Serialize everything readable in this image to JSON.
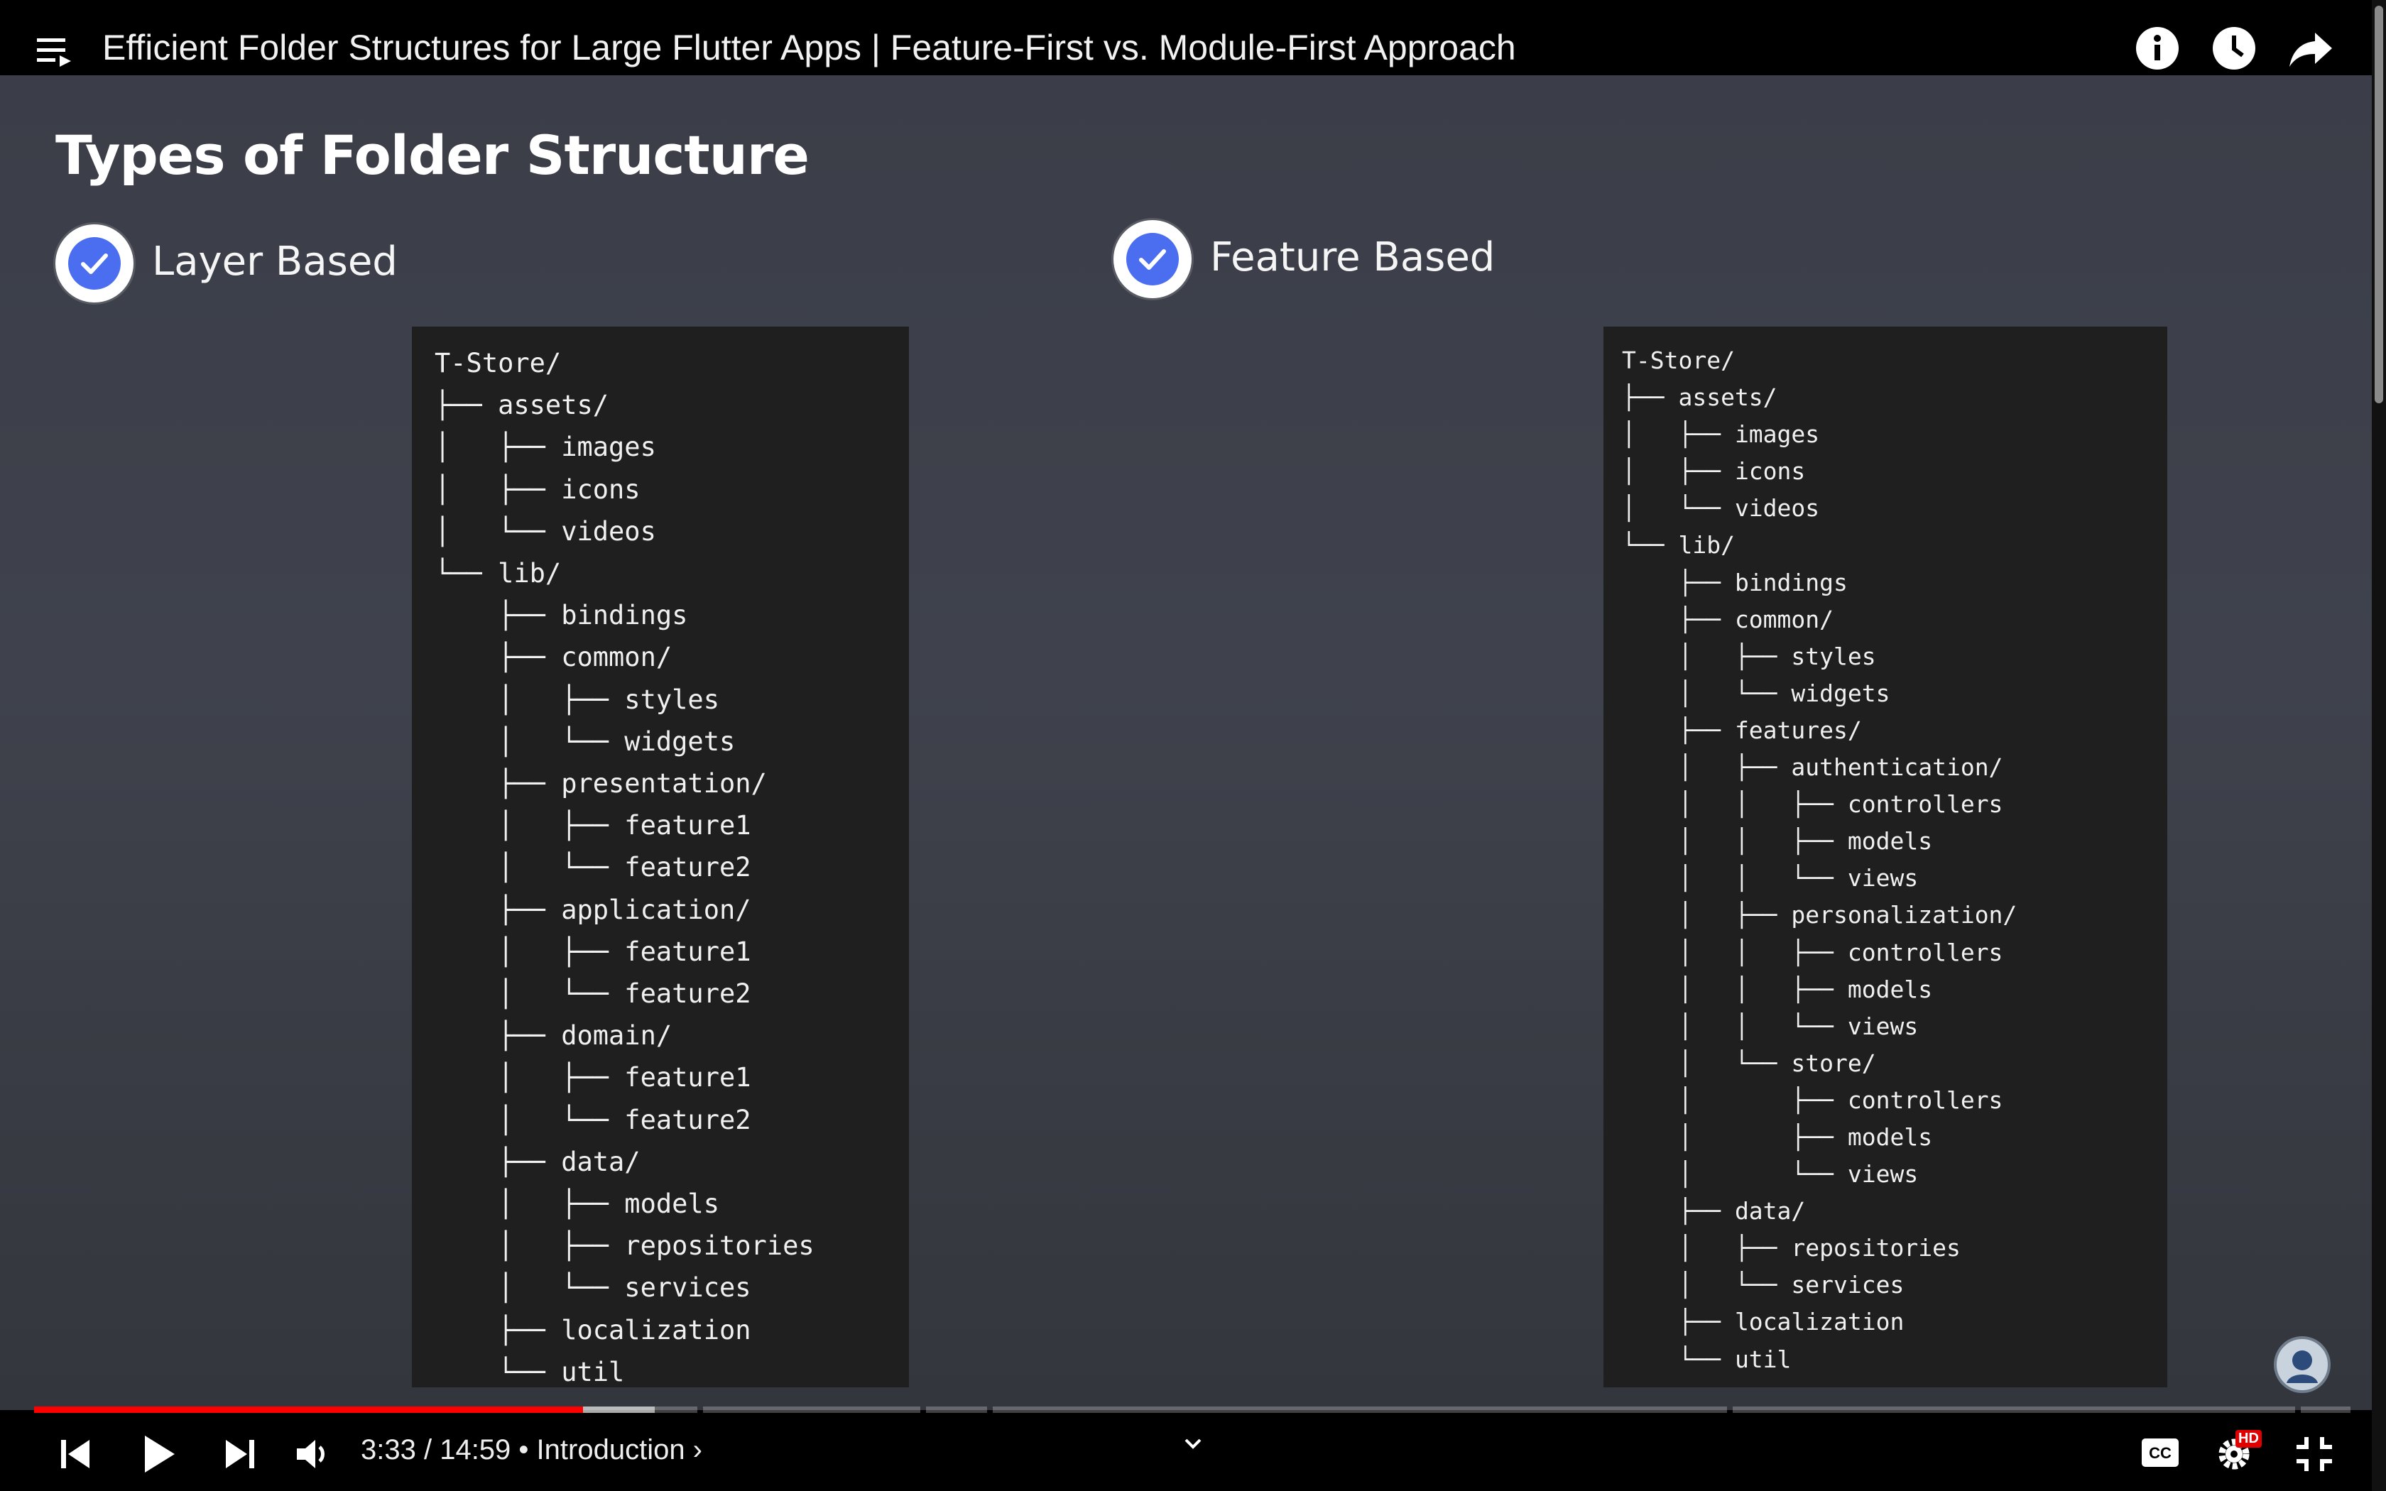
{
  "video": {
    "title": "Efficient Folder Structures for Large Flutter Apps | Feature-First vs. Module-First Approach"
  },
  "slide": {
    "title": "Types of Folder Structure",
    "options": [
      {
        "label": "Layer Based"
      },
      {
        "label": "Feature Based"
      }
    ],
    "layer_tree": "T-Store/\n├── assets/\n│   ├── images\n│   ├── icons\n│   └── videos\n└── lib/\n    ├── bindings\n    ├── common/\n    │   ├── styles\n    │   └── widgets\n    ├── presentation/\n    │   ├── feature1\n    │   └── feature2\n    ├── application/\n    │   ├── feature1\n    │   └── feature2\n    ├── domain/\n    │   ├── feature1\n    │   └── feature2\n    ├── data/\n    │   ├── models\n    │   ├── repositories\n    │   └── services\n    ├── localization\n    └── util",
    "feature_tree": "T-Store/\n├── assets/\n│   ├── images\n│   ├── icons\n│   └── videos\n└── lib/\n    ├── bindings\n    ├── common/\n    │   ├── styles\n    │   └── widgets\n    ├── features/\n    │   ├── authentication/\n    │   │   ├── controllers\n    │   │   ├── models\n    │   │   └── views\n    │   ├── personalization/\n    │   │   ├── controllers\n    │   │   ├── models\n    │   │   └── views\n    │   └── store/\n    │       ├── controllers\n    │       ├── models\n    │       └── views\n    ├── data/\n    │   ├── repositories\n    │   └── services\n    ├── localization\n    └── util"
  },
  "player": {
    "current_time": "3:33",
    "separator": " / ",
    "duration": "14:59",
    "bullet": " • ",
    "chapter": "Introduction ›",
    "progress_fraction": 0.237,
    "buffered_fraction": 0.268,
    "hd_badge": "HD"
  },
  "colors": {
    "progress_played": "#ff0000",
    "check_blue": "#4b6ef0",
    "tree_background": "#1f1f1f"
  },
  "icons": [
    "playlist-icon",
    "info-icon",
    "watch-later-icon",
    "share-icon",
    "check-icon",
    "prev-icon",
    "play-icon",
    "next-icon",
    "volume-icon",
    "chevron-down-icon",
    "captions-icon",
    "settings-icon",
    "fullscreen-exit-icon",
    "avatar-icon"
  ]
}
